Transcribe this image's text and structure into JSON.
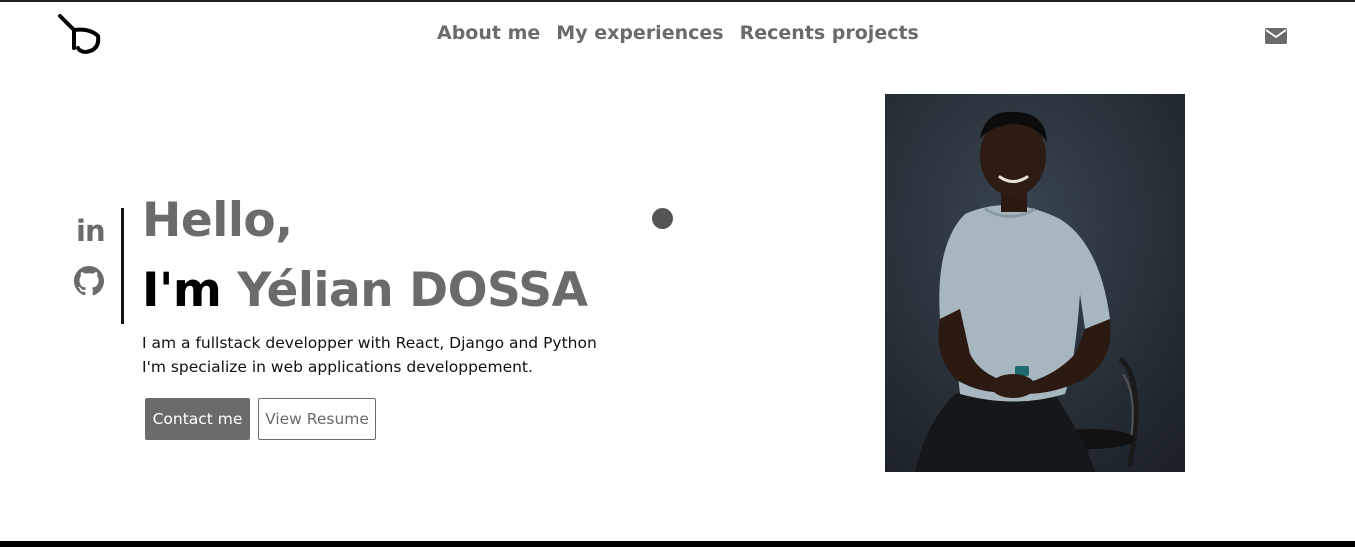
{
  "header": {
    "logo_name": "yd-logo",
    "nav": [
      {
        "label": "About me"
      },
      {
        "label": "My experiences"
      },
      {
        "label": "Recents projects"
      }
    ],
    "mail_icon": "envelope-icon"
  },
  "socials": {
    "linkedin_label": "in",
    "github_icon": "github-icon"
  },
  "hero": {
    "greeting": "Hello,",
    "name_prefix": "I'm ",
    "name": "Yélian DOSSA",
    "description_line1": "I am a fullstack developper with React, Django and Python",
    "description_line2": "I'm specialize in web applications developpement.",
    "contact_button": "Contact me",
    "resume_button": "View Resume"
  },
  "colors": {
    "accent": "#6b6b6b",
    "text": "#111111",
    "background": "#ffffff",
    "photo_bg": "#22292f"
  }
}
